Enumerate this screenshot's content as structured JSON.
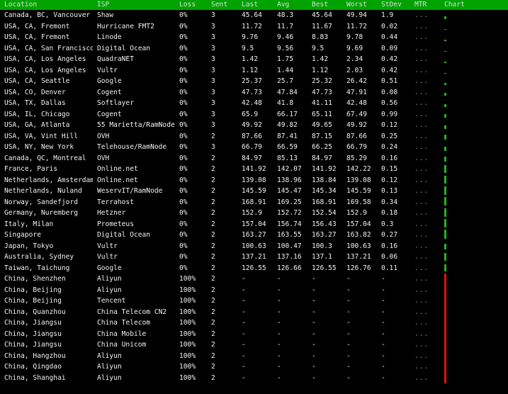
{
  "columns": {
    "location": "Location",
    "isp": "ISP",
    "loss": "Loss",
    "sent": "Sent",
    "last": "Last",
    "avg": "Avg",
    "best": "Best",
    "worst": "Worst",
    "stdev": "StDev",
    "mtr": "MTR",
    "chart": "Chart"
  },
  "colors": {
    "header_bg": "#00a300",
    "bar_ok": "#23b223",
    "bar_fail": "#e01010",
    "background": "#000000",
    "text": "#f2f2f2"
  },
  "rows": [
    {
      "location": "Canada, BC, Vancouver",
      "isp": "Shaw",
      "loss": "0%",
      "sent": "3",
      "last": "45.64",
      "avg": "48.3",
      "best": "45.64",
      "worst": "49.94",
      "stdev": "1.9",
      "mtr": "...",
      "chart_level": 0.25,
      "failed": false
    },
    {
      "location": "USA, CA, Fremont",
      "isp": "Hurricane FMT2",
      "loss": "0%",
      "sent": "3",
      "last": "11.72",
      "avg": "11.7",
      "best": "11.67",
      "worst": "11.72",
      "stdev": "0.02",
      "mtr": "...",
      "chart_level": 0.08,
      "failed": false
    },
    {
      "location": "USA, CA, Fremont",
      "isp": "Linode",
      "loss": "0%",
      "sent": "3",
      "last": "9.76",
      "avg": "9.46",
      "best": "8.83",
      "worst": "9.78",
      "stdev": "0.44",
      "mtr": "...",
      "chart_level": 0.07,
      "failed": false
    },
    {
      "location": "USA, CA, San Francisco",
      "isp": "Digital Ocean",
      "loss": "0%",
      "sent": "3",
      "last": "9.5",
      "avg": "9.56",
      "best": "9.5",
      "worst": "9.69",
      "stdev": "0.09",
      "mtr": "...",
      "chart_level": 0.07,
      "failed": false
    },
    {
      "location": "USA, CA, Los Angeles",
      "isp": "QuadraNET",
      "loss": "0%",
      "sent": "3",
      "last": "1.42",
      "avg": "1.75",
      "best": "1.42",
      "worst": "2.34",
      "stdev": "0.42",
      "mtr": "...",
      "chart_level": 0.03,
      "failed": false
    },
    {
      "location": "USA, CA, Los Angeles",
      "isp": "Vultr",
      "loss": "0%",
      "sent": "3",
      "last": "1.12",
      "avg": "1.44",
      "best": "1.12",
      "worst": "2.03",
      "stdev": "0.42",
      "mtr": "...",
      "chart_level": 0.03,
      "failed": false
    },
    {
      "location": "USA, CA, Seattle",
      "isp": "Google",
      "loss": "0%",
      "sent": "3",
      "last": "25.37",
      "avg": "25.7",
      "best": "25.32",
      "worst": "26.42",
      "stdev": "0.51",
      "mtr": "...",
      "chart_level": 0.15,
      "failed": false
    },
    {
      "location": "USA, CO, Denver",
      "isp": "Cogent",
      "loss": "0%",
      "sent": "3",
      "last": "47.73",
      "avg": "47.84",
      "best": "47.73",
      "worst": "47.91",
      "stdev": "0.08",
      "mtr": "...",
      "chart_level": 0.25,
      "failed": false
    },
    {
      "location": "USA, TX, Dallas",
      "isp": "Softlayer",
      "loss": "0%",
      "sent": "3",
      "last": "42.48",
      "avg": "41.8",
      "best": "41.11",
      "worst": "42.48",
      "stdev": "0.56",
      "mtr": "...",
      "chart_level": 0.23,
      "failed": false
    },
    {
      "location": "USA, IL, Chicago",
      "isp": "Cogent",
      "loss": "0%",
      "sent": "3",
      "last": "65.9",
      "avg": "66.17",
      "best": "65.11",
      "worst": "67.49",
      "stdev": "0.99",
      "mtr": "...",
      "chart_level": 0.33,
      "failed": false
    },
    {
      "location": "USA, GA, Atlanta",
      "isp": "55 Marietta/RamNode",
      "loss": "0%",
      "sent": "3",
      "last": "49.92",
      "avg": "49.82",
      "best": "49.65",
      "worst": "49.92",
      "stdev": "0.12",
      "mtr": "...",
      "chart_level": 0.27,
      "failed": false
    },
    {
      "location": "USA, VA, Vint Hill",
      "isp": "OVH",
      "loss": "0%",
      "sent": "2",
      "last": "87.66",
      "avg": "87.41",
      "best": "87.15",
      "worst": "87.66",
      "stdev": "0.25",
      "mtr": "...",
      "chart_level": 0.45,
      "failed": false
    },
    {
      "location": "USA, NY, New York",
      "isp": "Telehouse/RamNode",
      "loss": "0%",
      "sent": "3",
      "last": "66.79",
      "avg": "66.59",
      "best": "66.25",
      "worst": "66.79",
      "stdev": "0.24",
      "mtr": "...",
      "chart_level": 0.35,
      "failed": false
    },
    {
      "location": "Canada, QC, Montreal",
      "isp": "OVH",
      "loss": "0%",
      "sent": "2",
      "last": "84.97",
      "avg": "85.13",
      "best": "84.97",
      "worst": "85.29",
      "stdev": "0.16",
      "mtr": "...",
      "chart_level": 0.45,
      "failed": false
    },
    {
      "location": "France, Paris",
      "isp": "Online.net",
      "loss": "0%",
      "sent": "2",
      "last": "141.92",
      "avg": "142.07",
      "best": "141.92",
      "worst": "142.22",
      "stdev": "0.15",
      "mtr": "...",
      "chart_level": 0.7,
      "failed": false
    },
    {
      "location": "Netherlands, Amsterdam",
      "isp": "Online.net",
      "loss": "0%",
      "sent": "2",
      "last": "139.08",
      "avg": "138.96",
      "best": "138.84",
      "worst": "139.08",
      "stdev": "0.12",
      "mtr": "...",
      "chart_level": 0.7,
      "failed": false
    },
    {
      "location": "Netherlands, Nuland",
      "isp": "WeservIT/RamNode",
      "loss": "0%",
      "sent": "2",
      "last": "145.59",
      "avg": "145.47",
      "best": "145.34",
      "worst": "145.59",
      "stdev": "0.13",
      "mtr": "...",
      "chart_level": 0.72,
      "failed": false
    },
    {
      "location": "Norway, Sandefjord",
      "isp": "Terrahost",
      "loss": "0%",
      "sent": "2",
      "last": "168.91",
      "avg": "169.25",
      "best": "168.91",
      "worst": "169.58",
      "stdev": "0.34",
      "mtr": "...",
      "chart_level": 0.82,
      "failed": false
    },
    {
      "location": "Germany, Nuremberg",
      "isp": "Hetzner",
      "loss": "0%",
      "sent": "2",
      "last": "152.9",
      "avg": "152.72",
      "best": "152.54",
      "worst": "152.9",
      "stdev": "0.18",
      "mtr": "...",
      "chart_level": 0.75,
      "failed": false
    },
    {
      "location": "Italy, Milan",
      "isp": "Prometeus",
      "loss": "0%",
      "sent": "2",
      "last": "157.04",
      "avg": "156.74",
      "best": "156.43",
      "worst": "157.04",
      "stdev": "0.3",
      "mtr": "...",
      "chart_level": 0.77,
      "failed": false
    },
    {
      "location": "Singapore",
      "isp": "Digital Ocean",
      "loss": "0%",
      "sent": "2",
      "last": "163.27",
      "avg": "163.55",
      "best": "163.27",
      "worst": "163.82",
      "stdev": "0.27",
      "mtr": "...",
      "chart_level": 0.8,
      "failed": false
    },
    {
      "location": "Japan, Tokyo",
      "isp": "Vultr",
      "loss": "0%",
      "sent": "2",
      "last": "100.63",
      "avg": "100.47",
      "best": "100.3",
      "worst": "100.63",
      "stdev": "0.16",
      "mtr": "...",
      "chart_level": 0.52,
      "failed": false
    },
    {
      "location": "Australia, Sydney",
      "isp": "Vultr",
      "loss": "0%",
      "sent": "2",
      "last": "137.21",
      "avg": "137.16",
      "best": "137.1",
      "worst": "137.21",
      "stdev": "0.06",
      "mtr": "...",
      "chart_level": 0.68,
      "failed": false
    },
    {
      "location": "Taiwan, Taichung",
      "isp": "Google",
      "loss": "0%",
      "sent": "2",
      "last": "126.55",
      "avg": "126.66",
      "best": "126.55",
      "worst": "126.76",
      "stdev": "0.11",
      "mtr": "...",
      "chart_level": 0.63,
      "failed": false
    },
    {
      "location": "China, Shenzhen",
      "isp": "Aliyun",
      "loss": "100%",
      "sent": "2",
      "last": "-",
      "avg": "-",
      "best": "-",
      "worst": "-",
      "stdev": "-",
      "mtr": "...",
      "chart_level": 1.0,
      "failed": true
    },
    {
      "location": "China, Beijing",
      "isp": "Aliyun",
      "loss": "100%",
      "sent": "2",
      "last": "-",
      "avg": "-",
      "best": "-",
      "worst": "-",
      "stdev": "-",
      "mtr": "...",
      "chart_level": 1.0,
      "failed": true
    },
    {
      "location": "China, Beijing",
      "isp": "Tencent",
      "loss": "100%",
      "sent": "2",
      "last": "-",
      "avg": "-",
      "best": "-",
      "worst": "-",
      "stdev": "-",
      "mtr": "...",
      "chart_level": 1.0,
      "failed": true
    },
    {
      "location": "China, Quanzhou",
      "isp": "China Telecom CN2",
      "loss": "100%",
      "sent": "2",
      "last": "-",
      "avg": "-",
      "best": "-",
      "worst": "-",
      "stdev": "-",
      "mtr": "...",
      "chart_level": 1.0,
      "failed": true
    },
    {
      "location": "China, Jiangsu",
      "isp": "China Telecom",
      "loss": "100%",
      "sent": "2",
      "last": "-",
      "avg": "-",
      "best": "-",
      "worst": "-",
      "stdev": "-",
      "mtr": "...",
      "chart_level": 1.0,
      "failed": true
    },
    {
      "location": "China, Jiangsu",
      "isp": "China Mobile",
      "loss": "100%",
      "sent": "2",
      "last": "-",
      "avg": "-",
      "best": "-",
      "worst": "-",
      "stdev": "-",
      "mtr": "...",
      "chart_level": 1.0,
      "failed": true
    },
    {
      "location": "China, Jiangsu",
      "isp": "China Unicom",
      "loss": "100%",
      "sent": "2",
      "last": "-",
      "avg": "-",
      "best": "-",
      "worst": "-",
      "stdev": "-",
      "mtr": "...",
      "chart_level": 1.0,
      "failed": true
    },
    {
      "location": "China, Hangzhou",
      "isp": "Aliyun",
      "loss": "100%",
      "sent": "2",
      "last": "-",
      "avg": "-",
      "best": "-",
      "worst": "-",
      "stdev": "-",
      "mtr": "...",
      "chart_level": 1.0,
      "failed": true
    },
    {
      "location": "China, Qingdao",
      "isp": "Aliyun",
      "loss": "100%",
      "sent": "2",
      "last": "-",
      "avg": "-",
      "best": "-",
      "worst": "-",
      "stdev": "-",
      "mtr": "...",
      "chart_level": 1.0,
      "failed": true
    },
    {
      "location": "China, Shanghai",
      "isp": "Aliyun",
      "loss": "100%",
      "sent": "2",
      "last": "-",
      "avg": "-",
      "best": "-",
      "worst": "-",
      "stdev": "-",
      "mtr": "...",
      "chart_level": 1.0,
      "failed": true
    }
  ]
}
